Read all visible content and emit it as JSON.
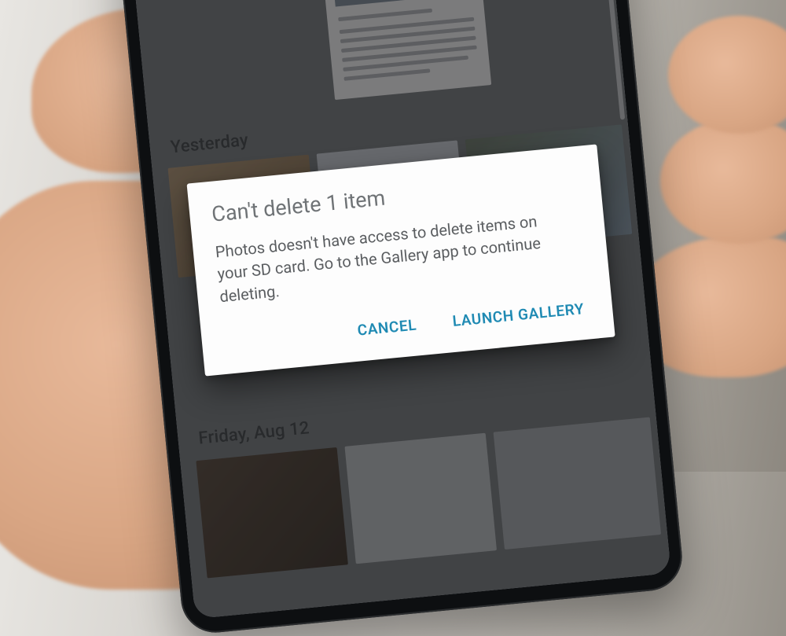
{
  "gallery": {
    "sections": [
      {
        "label": "Yesterday"
      },
      {
        "label": "Friday, Aug 12"
      }
    ]
  },
  "dialog": {
    "title": "Can't delete 1 item",
    "body": "Photos doesn't have access to delete items on your SD card. Go to the Gallery app to continue deleting.",
    "cancel_label": "CANCEL",
    "confirm_label": "LAUNCH GALLERY"
  },
  "colors": {
    "accent": "#1f8ab3"
  }
}
